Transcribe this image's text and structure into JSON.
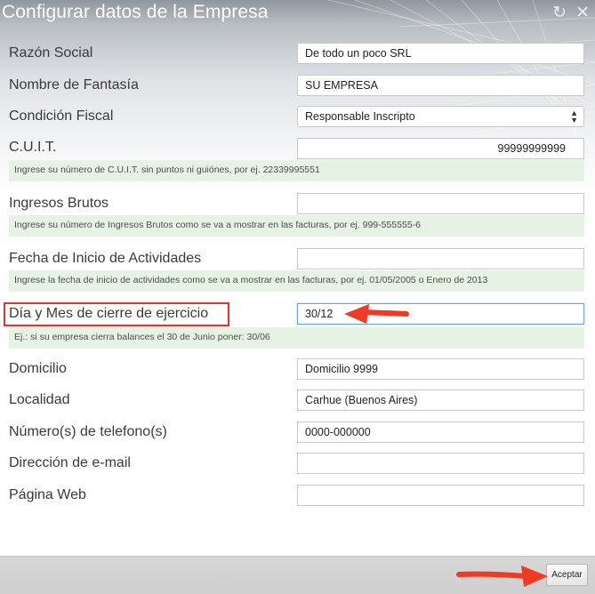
{
  "window": {
    "title": "Configurar datos de la Empresa",
    "icons": [
      "refresh-icon",
      "close-icon"
    ]
  },
  "fields": {
    "razon_social": {
      "label": "Razón Social",
      "value": "De todo un poco SRL"
    },
    "nombre_fantasia": {
      "label": "Nombre de Fantasía",
      "value": "SU EMPRESA"
    },
    "condicion_fiscal": {
      "label": "Condición Fiscal",
      "value": "Responsable Inscripto"
    },
    "cuit": {
      "label": "C.U.I.T.",
      "value": "99999999999",
      "hint": "Ingrese su número de C.U.I.T. sin puntos ni guiónes, por ej. 22339995551"
    },
    "ingresos_brutos": {
      "label": "Ingresos Brutos",
      "value": "",
      "hint": "Ingrese su número de Ingresos Brutos como se va a mostrar en las facturas, por ej. 999-555555-6"
    },
    "fecha_inicio": {
      "label": "Fecha de Inicio de Actividades",
      "value": "",
      "hint": "Ingrese la fecha de inicio de actividades como se va a mostrar en las facturas, por ej. 01/05/2005 o Enero de 2013"
    },
    "cierre_ejercicio": {
      "label": "Día y Mes de cierre de ejercicio",
      "value": "30/12",
      "hint": "Ej.: si su empresa cierra balances el 30 de Junio poner: 30/06"
    },
    "domicilio": {
      "label": "Domicilio",
      "value": "Domicilio 9999"
    },
    "localidad": {
      "label": "Localidad",
      "value": "Carhue (Buenos Aires)"
    },
    "telefono": {
      "label": "Número(s) de telefono(s)",
      "value": "0000-000000"
    },
    "email": {
      "label": "Dirección de e-mail",
      "value": ""
    },
    "web": {
      "label": "Página Web",
      "value": ""
    }
  },
  "footer": {
    "accept_label": "Aceptar"
  },
  "annotations": {
    "highlight_color": "#e5322d",
    "arrow_color": "#f03a24"
  }
}
